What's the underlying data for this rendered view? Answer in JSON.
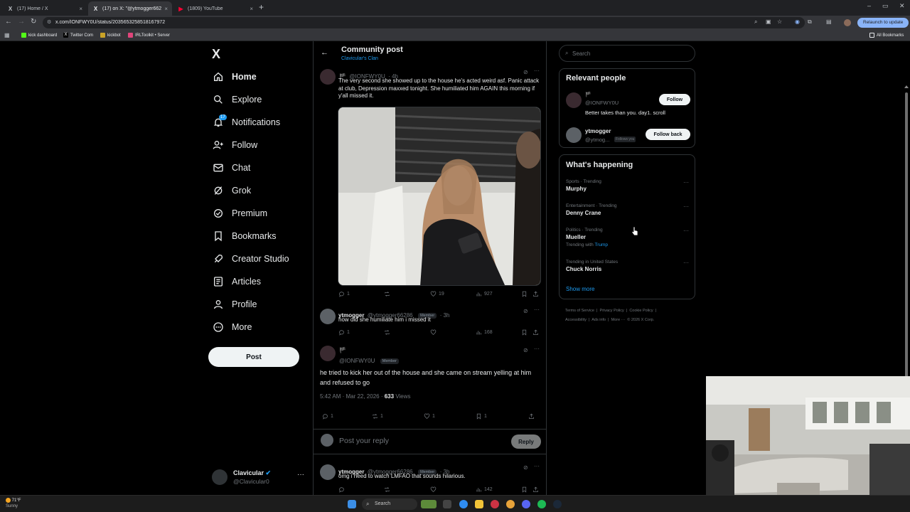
{
  "browser": {
    "tabs": [
      {
        "title": "(17) Home / X",
        "close": "×"
      },
      {
        "title": "(17) on X: \"@ytmogger66286",
        "close": "×"
      },
      {
        "title": "(1809) YouTube",
        "close": "×"
      }
    ],
    "new_tab": "+",
    "url": "x.com/IONFWY0U/status/2035653258518167972",
    "relaunch": "Relaunch to update",
    "bookmarks": [
      "kick dashboard",
      "Twitter Com",
      "kickbot",
      "IRLToolkit • Server"
    ],
    "all_bookmarks": "All Bookmarks",
    "window_controls": [
      "–",
      "▭",
      "✕"
    ]
  },
  "nav": {
    "logo": "X",
    "items": [
      {
        "label": "Home",
        "icon": "home-icon"
      },
      {
        "label": "Explore",
        "icon": "search-icon"
      },
      {
        "label": "Notifications",
        "icon": "bell-icon",
        "badge": "17"
      },
      {
        "label": "Follow",
        "icon": "person-plus-icon"
      },
      {
        "label": "Chat",
        "icon": "mail-icon"
      },
      {
        "label": "Grok",
        "icon": "grok-icon"
      },
      {
        "label": "Premium",
        "icon": "premium-icon"
      },
      {
        "label": "Bookmarks",
        "icon": "bookmark-icon"
      },
      {
        "label": "Creator Studio",
        "icon": "rocket-icon"
      },
      {
        "label": "Articles",
        "icon": "article-icon"
      },
      {
        "label": "Profile",
        "icon": "profile-icon"
      },
      {
        "label": "More",
        "icon": "more-circle-icon"
      }
    ],
    "post_button": "Post",
    "account": {
      "name": "Clavicular",
      "handle": "@Clavicular0",
      "more": "···"
    }
  },
  "header": {
    "title": "Community post",
    "subtitle": "Clavicular's Clan",
    "back": "←"
  },
  "posts": [
    {
      "handle": "@IONFWY0U",
      "time": "· 4h",
      "text": "The very second she showed up to the house he's acted weird asf. Panic attack at club, Depression maxxed tonight. She humiliated him AGAIN this morning if y'all missed it.",
      "replies": "1",
      "reposts": "",
      "likes": "19",
      "views": "927"
    },
    {
      "name": "ytmogger",
      "handle": "@ytmogger66286",
      "badge": "Member",
      "time": "· 3h",
      "text": "how did she humiliate him i missed it",
      "replies": "1",
      "reposts": "",
      "likes": "",
      "views": "168"
    }
  ],
  "main_post": {
    "handle": "@IONFWY0U",
    "badge": "Member",
    "text": "he tried to kick her out of the house and she came on stream yelling at him and refused to go",
    "timestamp": "5:42 AM · Mar 22, 2026 ·",
    "views_count": "633",
    "views_label": "Views",
    "replies": "1",
    "reposts": "1",
    "likes": "1",
    "bookmarks": "1"
  },
  "reply_box": {
    "placeholder": "Post your reply",
    "button": "Reply"
  },
  "bottom_post": {
    "name": "ytmogger",
    "handle": "@ytmogger66286",
    "badge": "Member",
    "time": "· 3h",
    "text": "omg i need to watch LMFAO that sounds hilarious.",
    "views": "142"
  },
  "right": {
    "search_placeholder": "Search",
    "relevant_title": "Relevant people",
    "people": [
      {
        "name": "",
        "handle": "@IONFWY0U",
        "bio": "Better takes than you. day1. scroll",
        "button": "Follow"
      },
      {
        "name": "ytmogger",
        "handle": "@ytmog...",
        "follows_you": "Follows you",
        "button": "Follow back"
      }
    ],
    "happening_title": "What's happening",
    "trends": [
      {
        "category": "Sports · Trending",
        "title": "Murphy"
      },
      {
        "category": "Entertainment · Trending",
        "title": "Denny Crane"
      },
      {
        "category": "Politics · Trending",
        "title": "Mueller",
        "sub_prefix": "Trending with",
        "sub_link": "Trump"
      },
      {
        "category": "Trending in United States",
        "title": "Chuck Norris"
      }
    ],
    "show_more": "Show more",
    "footer_line1": [
      "Terms of Service",
      "|",
      "Privacy Policy",
      "|",
      "Cookie Policy",
      "|"
    ],
    "footer_line2": [
      "Accessibility",
      "|",
      "Ads info",
      "|",
      "More ···",
      "© 2026 X Corp."
    ]
  },
  "taskbar": {
    "weather_temp": "71°F",
    "weather_desc": "Sunny",
    "search": "Search"
  },
  "colors": {
    "accent": "#1d9bf0",
    "bg": "#000000",
    "border": "#2f3336",
    "muted": "#71767b"
  }
}
